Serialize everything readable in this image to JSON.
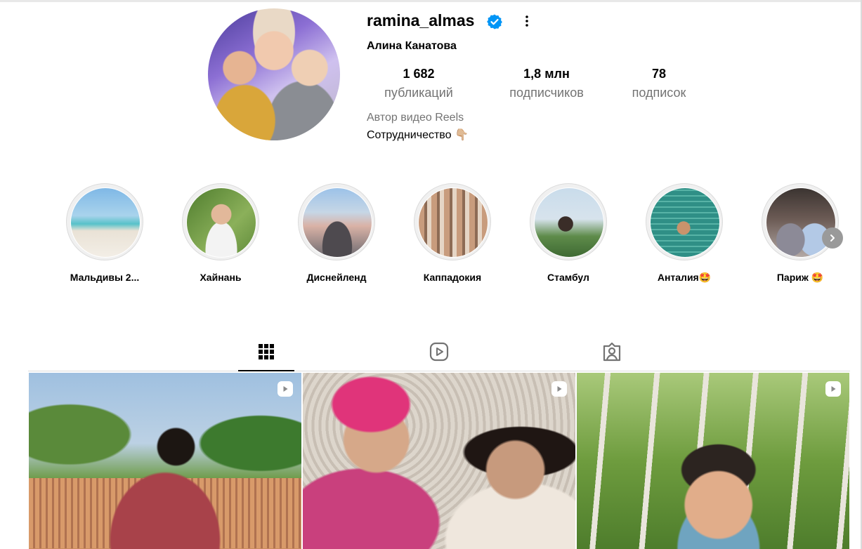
{
  "profile": {
    "username": "ramina_almas",
    "full_name": "Алина Канатова",
    "verified": true,
    "category": "Автор видео Reels",
    "bio": "Сотрудничество 👇🏼"
  },
  "stats": [
    {
      "value": "1 682",
      "label": "публикаций"
    },
    {
      "value": "1,8 млн",
      "label": "подписчиков"
    },
    {
      "value": "78",
      "label": "подписок"
    }
  ],
  "highlights": [
    {
      "label": "Мальдивы 2..."
    },
    {
      "label": "Хайнань"
    },
    {
      "label": "Диснейленд"
    },
    {
      "label": "Каппадокия"
    },
    {
      "label": "Стамбул"
    },
    {
      "label": "Анталия🤩"
    },
    {
      "label": "Париж 🤩"
    }
  ],
  "tabs": [
    {
      "icon": "grid-icon",
      "active": true
    },
    {
      "icon": "reels-icon",
      "active": false
    },
    {
      "icon": "tagged-icon",
      "active": false
    }
  ],
  "posts": [
    {
      "type": "reel"
    },
    {
      "type": "reel"
    },
    {
      "type": "reel"
    }
  ],
  "colors": {
    "verified": "#0095f6",
    "secondary_text": "#737373",
    "border": "#dbdbdb"
  }
}
